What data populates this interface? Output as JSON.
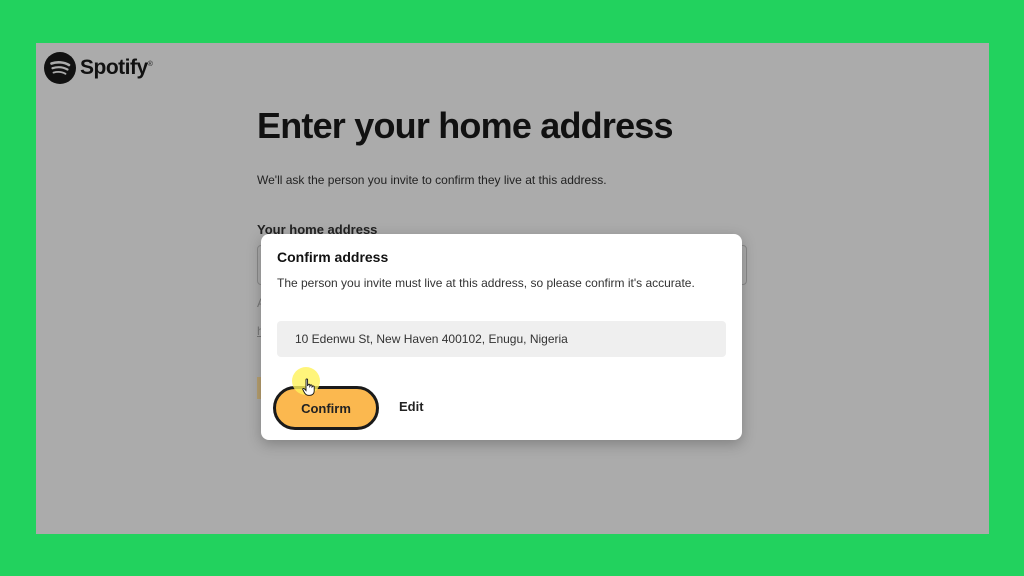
{
  "brand": {
    "name": "Spotify",
    "trademark": "®",
    "icon": "spotify-logo-icon"
  },
  "page": {
    "title": "Enter your home address",
    "subtitle": "We'll ask the person you invite to confirm they live at this address.",
    "field_label": "Your home address"
  },
  "dialog": {
    "title": "Confirm address",
    "body": "The person you invite must live at this address, so please confirm it's accurate.",
    "address": "10 Edenwu St, New Haven 400102, Enugu, Nigeria",
    "confirm_label": "Confirm",
    "edit_label": "Edit"
  },
  "colors": {
    "background_frame": "#22d25e",
    "overlay": "#ababab",
    "confirm_button": "#fbb84f"
  },
  "icons": {
    "cursor": "hand-pointer-icon"
  }
}
